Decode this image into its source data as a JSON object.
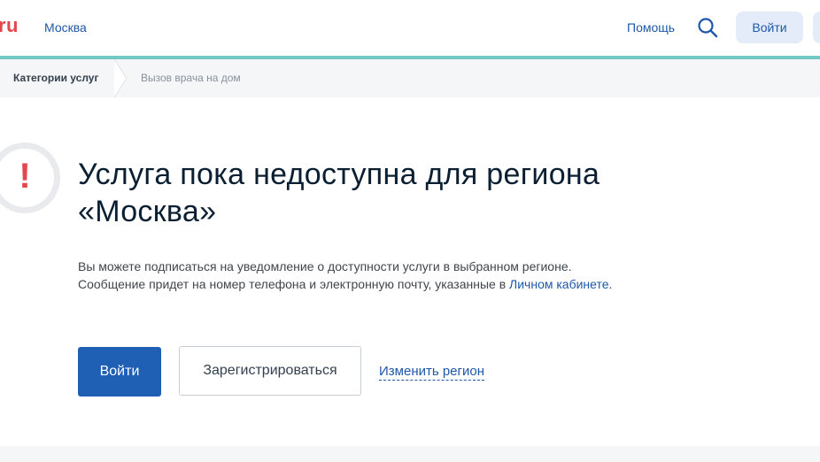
{
  "header": {
    "logo": "ru",
    "region": "Москва",
    "help": "Помощь",
    "login": "Войти"
  },
  "breadcrumbs": {
    "root": "Категории услуг",
    "current": "Вызов врача на дом"
  },
  "main": {
    "alert_symbol": "!",
    "title_line1": "Услуга пока недоступна для региона",
    "title_line2": "«Москва»",
    "desc_line1": "Вы можете подписаться на уведомление о доступности услуги в выбранном регионе.",
    "desc_line2_start": "Сообщение придет на номер телефона и электронную почту, указанные в ",
    "desc_link": "Личном кабинете",
    "desc_end": ".",
    "login_button": "Войти",
    "register_button": "Зарегистрироваться",
    "change_region": "Изменить регион"
  },
  "colors": {
    "accent": "#1f5fb4",
    "header_line": "#6fc8c4",
    "alert": "#e3464c"
  }
}
